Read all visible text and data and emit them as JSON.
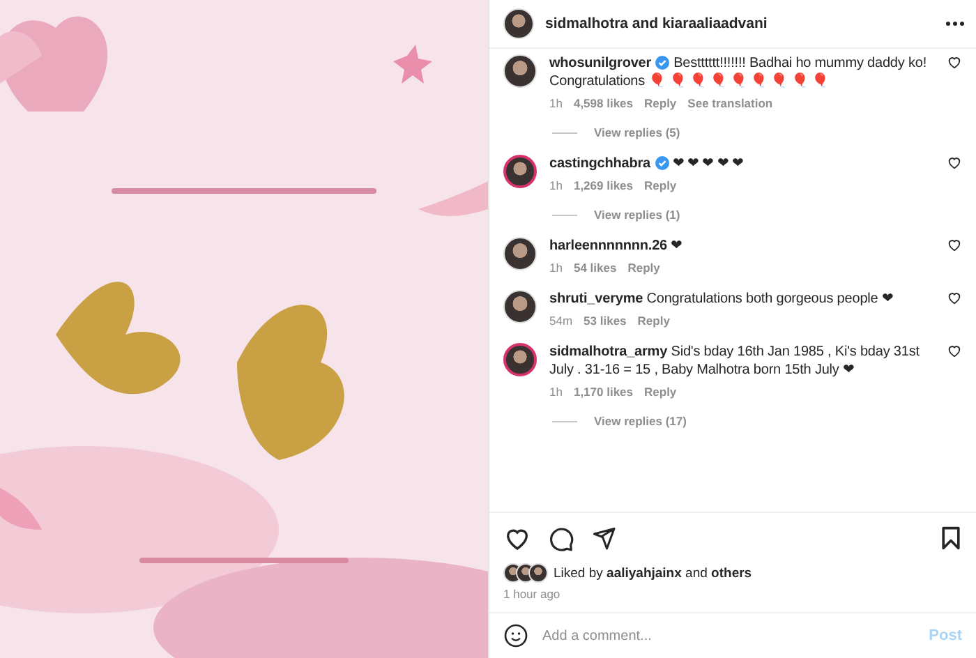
{
  "header": {
    "authors": "sidmalhotra and kiaraaliaadvani"
  },
  "comments": [
    {
      "user": "whosunilgrover",
      "verified": true,
      "text": "Bestttttt!!!!!!! Badhai ho mummy daddy ko! Congratulations 🎈 🎈 🎈 🎈 🎈 🎈 🎈 🎈 🎈",
      "time": "1h",
      "likes": "4,598 likes",
      "reply": "Reply",
      "translate": "See translation",
      "view_replies": "View replies (5)",
      "story_ring": false
    },
    {
      "user": "castingchhabra",
      "verified": true,
      "text": "❤ ❤ ❤ ❤ ❤",
      "time": "1h",
      "likes": "1,269 likes",
      "reply": "Reply",
      "view_replies": "View replies (1)",
      "story_ring": true
    },
    {
      "user": "harleennnnnnn.26",
      "verified": false,
      "text": "❤",
      "time": "1h",
      "likes": "54 likes",
      "reply": "Reply",
      "story_ring": false
    },
    {
      "user": "shruti_veryme",
      "verified": false,
      "text": "Congratulations both gorgeous people ❤",
      "time": "54m",
      "likes": "53 likes",
      "reply": "Reply",
      "story_ring": false
    },
    {
      "user": "sidmalhotra_army",
      "verified": false,
      "text": "Sid's bday 16th Jan 1985 , Ki's bday 31st July . 31-16 = 15 , Baby Malhotra born 15th July ❤",
      "time": "1h",
      "likes": "1,170 likes",
      "reply": "Reply",
      "view_replies": "View replies (17)",
      "story_ring": true
    }
  ],
  "likes_line": "Liked by **aaliyahjainx** and **others**",
  "posted": "1 hour ago",
  "comment_box": {
    "placeholder": "Add a comment...",
    "post": "Post"
  }
}
